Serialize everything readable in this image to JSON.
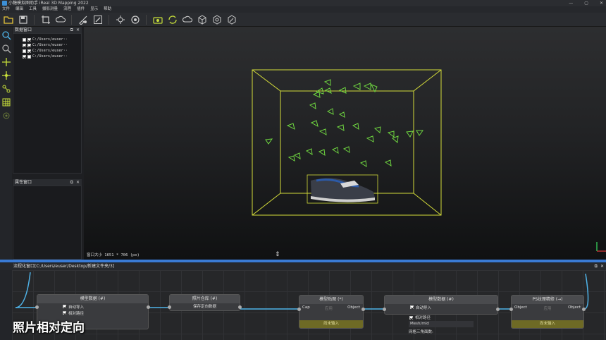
{
  "window": {
    "title": "小糖模拟图助手 iReal 3D Mapping 2022",
    "buttons": [
      "—",
      "▢",
      "✕"
    ]
  },
  "menu": [
    "文件",
    "编辑",
    "工具",
    "摄影测量",
    "流程",
    "插件",
    "显示",
    "帮助"
  ],
  "toolbar_icons": [
    "open-folder-icon",
    "save-icon",
    "crop-icon",
    "cloud-icon",
    "paint-icon",
    "edit-icon",
    "target-icon",
    "gear-icon",
    "camera-icon",
    "camera-sync-icon",
    "cloud-upload-icon",
    "cube-icon",
    "cube-refresh-icon",
    "cube-edit-icon"
  ],
  "left_tools": [
    "zoom-icon",
    "zoom-region-icon",
    "move-axis-icon",
    "add-point-icon",
    "graph-icon",
    "grid-icon",
    "target-dot-icon"
  ],
  "data_panel": {
    "title": "数据窗口",
    "items": [
      {
        "label": "C:/Users/euser··",
        "checked": false
      },
      {
        "label": "C:/Users/euser··",
        "checked": true
      },
      {
        "label": "C:/Users/euser··",
        "checked": false
      },
      {
        "label": "C:/Users/euser··",
        "checked": true
      }
    ]
  },
  "property_panel": {
    "title": "属性窗口"
  },
  "viewport": {
    "status": "窗口大小 1651 * 706 (px)"
  },
  "flow": {
    "title": "流程化窗口[C:/Users/euser/Desktop/新建文件夹/3]",
    "nodes": {
      "model_data_1": {
        "title": "模型数据 (#)",
        "opt1": "自动导入",
        "opt2": "相对路径"
      },
      "photo_store": {
        "title": "照片仓库 (#)",
        "btn": "保存定向数据"
      },
      "texture": {
        "title": "模型贴图 (*)",
        "in": "Cap",
        "mid": "应用",
        "out": "Object",
        "foot": "尚未输入"
      },
      "model_data_2": {
        "title": "模型数据 (#)",
        "opt1": "自动导入",
        "opt2": "相对路径",
        "mesh": "Mesh/mld",
        "tri": "网格三角面数:"
      },
      "ps_texture": {
        "title": "PS纹理精修 (→)",
        "in": "Object",
        "mid": "应用",
        "out": "Object",
        "foot": "尚未输入"
      }
    }
  },
  "caption": "照片相对定向"
}
